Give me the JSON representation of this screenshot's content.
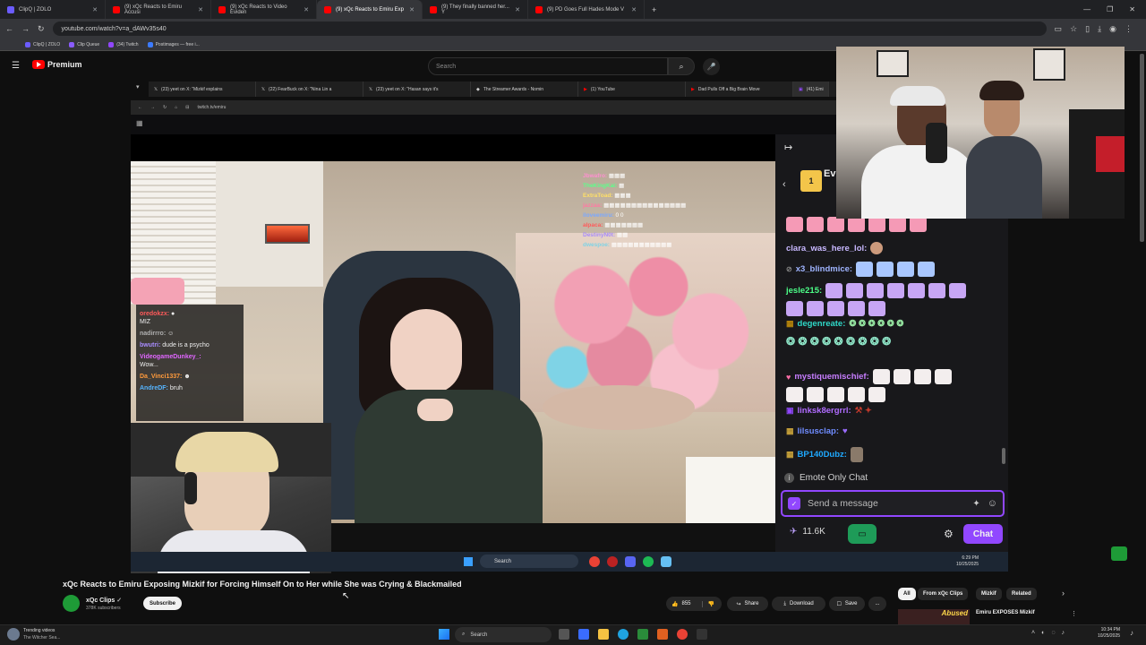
{
  "browser": {
    "tabs": [
      {
        "label": "ClipQ | ZOLO",
        "color": "#6b5cff"
      },
      {
        "label": "(9) xQc Reacts to Emiru Accusi",
        "color": "#ff0000"
      },
      {
        "label": "(9) xQc Reacts to Video Eviden",
        "color": "#ff0000"
      },
      {
        "label": "(9) xQc Reacts to Emiru Exp",
        "color": "#ff0000"
      },
      {
        "label": "(9) They finally banned her... Y",
        "color": "#ff0000"
      },
      {
        "label": "(9) PD Goes Full Hades Mode V",
        "color": "#ff0000"
      }
    ],
    "new_tab": "+",
    "url": "youtube.com/watch?v=a_dAWv35s40",
    "bookmarks": [
      "ClipQ | ZOLO",
      "Clip Queue",
      "(34) Twitch",
      "Postimages — free i..."
    ]
  },
  "youtube": {
    "logo_label": "Premium",
    "search_placeholder": "Search",
    "video_title": "xQc Reacts to Emiru Exposing Mizkif for Forcing Himself On to Her while She was Crying & Blackmailed",
    "channel_name": "xQc Clips",
    "channel_subs": "378K subscribers",
    "subscribe_label": "Subscribe",
    "like_count": "855",
    "share_label": "Share",
    "download_label": "Download",
    "save_label": "Save",
    "more_label": "...",
    "chips": [
      "All",
      "From xQc Clips",
      "Mizkif",
      "Related"
    ],
    "related_title": "Emiru EXPOSES Mizkif",
    "related_thumb_text": "Abused"
  },
  "inner_browser": {
    "tabs": [
      "(23) yeet on X: \"Mizkif explains",
      "(22) FearBuck on X: \"Nina Lin a",
      "(23) yeet on X: \"Hasan says it's",
      "The Streamer Awards - Nomin",
      "(1) YouTube",
      "Dad Pulls Off a Big Brain Move",
      "(41) Emi"
    ],
    "url": "twitch.tv/emiru",
    "taskbar_search": "Search",
    "clock_time": "6:29 PM",
    "clock_date": "10/25/2025"
  },
  "mini_chat": [
    {
      "user": "oredokzx:",
      "text": "MIZ",
      "color": "#ff5a5a"
    },
    {
      "user": "nadirrro:",
      "text": "",
      "color": "#b0b0b0"
    },
    {
      "user": "bwutri:",
      "text": "dude is a psycho",
      "color": "#a88cff"
    },
    {
      "user": "VideogameDunkey_:",
      "text": "Wow...",
      "color": "#e066ff"
    },
    {
      "user": "Da_Vinci1337:",
      "text": "",
      "color": "#ff9a3c"
    },
    {
      "user": "AndreDF:",
      "text": "bruh",
      "color": "#56b4ff"
    }
  ],
  "stream_chat": {
    "header_glyph": "Ev",
    "lines": [
      {
        "user": "clara_was_here_lol:",
        "color": "#c8b8ff"
      },
      {
        "user": "x3_blindmice:",
        "color": "#9fb4ff"
      },
      {
        "user": "jesle215:",
        "color": "#4cff88"
      },
      {
        "user": "degenreate:",
        "color": "#2fd8c8"
      },
      {
        "user": "mystiquemischief:",
        "color": "#c77dff"
      },
      {
        "user": "linksk8ergrrl:",
        "color": "#b06cff"
      },
      {
        "user": "lilsusclap:",
        "color": "#6f8cff"
      },
      {
        "user": "BP140Dubz:",
        "color": "#1fa9ff"
      }
    ],
    "emote_only_label": "Emote Only Chat",
    "input_placeholder": "Send a message",
    "points": "11.6K",
    "chat_button": "Chat"
  },
  "taskbar": {
    "weather_title": "Trending videos",
    "weather_sub": "The Witcher Sea...",
    "search_label": "Search",
    "time": "10:34 PM",
    "date": "10/25/2025"
  },
  "colors": {
    "youtube_red": "#ff0000",
    "twitch_purple": "#9147ff",
    "chat_bg": "#18181b"
  }
}
